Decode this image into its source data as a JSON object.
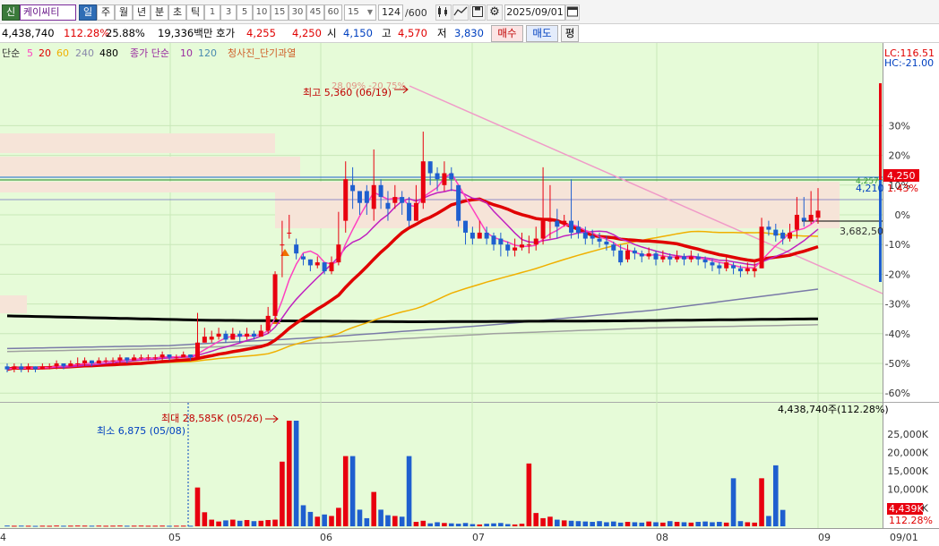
{
  "toolbar": {
    "account_tag": "신",
    "stock_name": "케이씨티",
    "periods": [
      "일",
      "주",
      "월",
      "년",
      "분",
      "초",
      "틱"
    ],
    "intervals": [
      "1",
      "3",
      "5",
      "10",
      "15",
      "30",
      "45",
      "60"
    ],
    "interval_selected": "15",
    "count": "124",
    "count_total": "/600",
    "date": "2025/09/01"
  },
  "quote": {
    "volume": "4,438,740",
    "volume_ratio": "112.28%",
    "turnover": "25.88%",
    "amount": "19,336백만",
    "ask_label": "호가",
    "ask_price": "4,255",
    "bid_price": "4,250",
    "open_label": "시",
    "open": "4,150",
    "high_label": "고",
    "high": "4,570",
    "low_label": "저",
    "low": "3,830",
    "buy_label": "매수",
    "sell_label": "매도",
    "eval_label": "평"
  },
  "legend": {
    "ma_label": "단순",
    "ma_5": "5",
    "ma_20": "20",
    "ma_60": "60",
    "ma_240": "240",
    "ma_480": "480",
    "vol_label": "종가 단순",
    "vol_10": "10",
    "vol_120": "120",
    "signal": "청사진_단기과열",
    "lc": "LC:116.51",
    "hc": "HC:-21.00"
  },
  "price_axis": [
    "30%",
    "20%",
    "10%",
    "0%",
    "-10%",
    "-20%",
    "-30%",
    "-40%",
    "-50%",
    "-60%"
  ],
  "price_tags": {
    "current": "4,250",
    "current_pct": "1.43%",
    "prev": "4,210",
    "prev_small": "4,257",
    "level": "3,682,50"
  },
  "annotations": {
    "high": "최고 5,360 (06/19)",
    "high_sub": "28.09% -20.75%",
    "vol_max": "최대 28,585K (05/26)",
    "vol_min": "최소 6,875 (05/08)",
    "vol_total": "4,438,740주(112.28%)"
  },
  "volume_axis": [
    "25,000K",
    "20,000K",
    "15,000K",
    "10,000K",
    "5,000K"
  ],
  "volume_tags": {
    "current": "4,439K",
    "pct": "112.28%"
  },
  "x_axis": [
    "4",
    "05",
    "06",
    "07",
    "08",
    "09",
    "09/01"
  ],
  "colors": {
    "up": "#e8000f",
    "down": "#1f5fcf",
    "bg": "#e6fbd8",
    "ma5": "#ff40c0",
    "ma20": "#e00000",
    "ma60": "#f0b000",
    "ma480": "#000000"
  },
  "chart_data": {
    "type": "candlestick",
    "price_axis_pct": [
      30,
      20,
      10,
      0,
      -10,
      -20,
      -30,
      -40,
      -50,
      -60
    ],
    "price_range_pct": [
      -65,
      35
    ],
    "volume_range_K": [
      0,
      28585
    ],
    "volume_axis_K": [
      25000,
      20000,
      15000,
      10000,
      5000
    ],
    "candles": [
      {
        "c": -52,
        "h": -50,
        "l": -53,
        "o": -51
      },
      {
        "c": -51,
        "h": -50,
        "l": -53,
        "o": -52
      },
      {
        "c": -52,
        "h": -50,
        "l": -53,
        "o": -51
      },
      {
        "c": -51,
        "h": -50,
        "l": -53,
        "o": -52
      },
      {
        "c": -52,
        "h": -51,
        "l": -53,
        "o": -51
      },
      {
        "c": -51,
        "h": -50,
        "l": -52,
        "o": -52
      },
      {
        "c": -51,
        "h": -50,
        "l": -52,
        "o": -51
      },
      {
        "c": -50,
        "h": -49,
        "l": -52,
        "o": -51
      },
      {
        "c": -51,
        "h": -50,
        "l": -52,
        "o": -50
      },
      {
        "c": -50,
        "h": -49,
        "l": -51,
        "o": -51
      },
      {
        "c": -50,
        "h": -48,
        "l": -51,
        "o": -50
      },
      {
        "c": -49,
        "h": -48,
        "l": -51,
        "o": -50
      },
      {
        "c": -50,
        "h": -49,
        "l": -51,
        "o": -49
      },
      {
        "c": -49,
        "h": -48,
        "l": -50,
        "o": -50
      },
      {
        "c": -49,
        "h": -48,
        "l": -50,
        "o": -49
      },
      {
        "c": -49,
        "h": -48,
        "l": -50,
        "o": -49
      },
      {
        "c": -48,
        "h": -47,
        "l": -50,
        "o": -49
      },
      {
        "c": -49,
        "h": -48,
        "l": -50,
        "o": -48
      },
      {
        "c": -48,
        "h": -47,
        "l": -49,
        "o": -49
      },
      {
        "c": -48,
        "h": -47,
        "l": -49,
        "o": -48
      },
      {
        "c": -48,
        "h": -47,
        "l": -49,
        "o": -48
      },
      {
        "c": -48,
        "h": -47,
        "l": -49,
        "o": -48
      },
      {
        "c": -47,
        "h": -46,
        "l": -49,
        "o": -48
      },
      {
        "c": -48,
        "h": -47,
        "l": -49,
        "o": -47
      },
      {
        "c": -48,
        "h": -47,
        "l": -49,
        "o": -48
      },
      {
        "c": -47,
        "h": -46,
        "l": -48,
        "o": -48
      },
      {
        "c": -48,
        "h": -47,
        "l": -49,
        "o": -47
      },
      {
        "c": -43,
        "h": -33,
        "l": -48,
        "o": -48
      },
      {
        "c": -41,
        "h": -38,
        "l": -43,
        "o": -43
      },
      {
        "c": -41,
        "h": -39,
        "l": -43,
        "o": -42
      },
      {
        "c": -40,
        "h": -38,
        "l": -42,
        "o": -41
      },
      {
        "c": -42,
        "h": -39,
        "l": -43,
        "o": -40
      },
      {
        "c": -40,
        "h": -38,
        "l": -42,
        "o": -42
      },
      {
        "c": -41,
        "h": -39,
        "l": -43,
        "o": -40
      },
      {
        "c": -40,
        "h": -38,
        "l": -42,
        "o": -41
      },
      {
        "c": -41,
        "h": -39,
        "l": -42,
        "o": -40
      },
      {
        "c": -39,
        "h": -37,
        "l": -41,
        "o": -41
      },
      {
        "c": -34,
        "h": -31,
        "l": -40,
        "o": -39
      },
      {
        "c": -20,
        "h": -19,
        "l": -35,
        "o": -34
      },
      {
        "c": -10,
        "h": -2,
        "l": -21,
        "o": -10
      },
      {
        "c": -6,
        "h": 0,
        "l": -8,
        "o": -6
      },
      {
        "c": -13,
        "h": -8,
        "l": -15,
        "o": -10
      },
      {
        "c": -15,
        "h": -13,
        "l": -17,
        "o": -14
      },
      {
        "c": -17,
        "h": -15,
        "l": -19,
        "o": -15
      },
      {
        "c": -16,
        "h": -14,
        "l": -18,
        "o": -17
      },
      {
        "c": -19,
        "h": -16,
        "l": -20,
        "o": -16
      },
      {
        "c": -16,
        "h": -14,
        "l": -20,
        "o": -19
      },
      {
        "c": -10,
        "h": 1,
        "l": -17,
        "o": -16
      },
      {
        "c": 12,
        "h": 18,
        "l": -6,
        "o": -2
      },
      {
        "c": 8,
        "h": 16,
        "l": 2,
        "o": 10
      },
      {
        "c": 4,
        "h": 8,
        "l": 0,
        "o": 8
      },
      {
        "c": 4,
        "h": 10,
        "l": 0,
        "o": 8
      },
      {
        "c": 10,
        "h": 22,
        "l": -2,
        "o": 2
      },
      {
        "c": 6,
        "h": 12,
        "l": 2,
        "o": 10
      },
      {
        "c": 2,
        "h": 8,
        "l": -2,
        "o": 4
      },
      {
        "c": 6,
        "h": 10,
        "l": 2,
        "o": 4
      },
      {
        "c": 4,
        "h": 8,
        "l": 0,
        "o": 6
      },
      {
        "c": -2,
        "h": 6,
        "l": -4,
        "o": 4
      },
      {
        "c": 4,
        "h": 10,
        "l": -2,
        "o": -2
      },
      {
        "c": 18,
        "h": 28,
        "l": 2,
        "o": 4
      },
      {
        "c": 14,
        "h": 18,
        "l": 10,
        "o": 18
      },
      {
        "c": 12,
        "h": 16,
        "l": 8,
        "o": 14
      },
      {
        "c": 14,
        "h": 18,
        "l": 8,
        "o": 10
      },
      {
        "c": 12,
        "h": 16,
        "l": 8,
        "o": 14
      },
      {
        "c": -2,
        "h": 10,
        "l": -4,
        "o": 10
      },
      {
        "c": -6,
        "h": -2,
        "l": -10,
        "o": -2
      },
      {
        "c": -8,
        "h": -4,
        "l": -10,
        "o": -6
      },
      {
        "c": -6,
        "h": -2,
        "l": -8,
        "o": -8
      },
      {
        "c": -8,
        "h": -4,
        "l": -10,
        "o": -6
      },
      {
        "c": -10,
        "h": -6,
        "l": -12,
        "o": -7
      },
      {
        "c": -10,
        "h": -6,
        "l": -14,
        "o": -8
      },
      {
        "c": -12,
        "h": -9,
        "l": -14,
        "o": -10
      },
      {
        "c": -11,
        "h": -8,
        "l": -14,
        "o": -12
      },
      {
        "c": -10,
        "h": -6,
        "l": -12,
        "o": -11
      },
      {
        "c": -10,
        "h": -7,
        "l": -13,
        "o": -10
      },
      {
        "c": -8,
        "h": -4,
        "l": -12,
        "o": -10
      },
      {
        "c": -2,
        "h": 16,
        "l": -10,
        "o": -8
      },
      {
        "c": -2,
        "h": 10,
        "l": -8,
        "o": -2
      },
      {
        "c": -4,
        "h": 2,
        "l": -8,
        "o": -2
      },
      {
        "c": -2,
        "h": 0,
        "l": -4,
        "o": -3
      },
      {
        "c": -6,
        "h": 12,
        "l": -8,
        "o": -2
      },
      {
        "c": -6,
        "h": -2,
        "l": -8,
        "o": -4
      },
      {
        "c": -8,
        "h": -4,
        "l": -10,
        "o": -6
      },
      {
        "c": -8,
        "h": -5,
        "l": -10,
        "o": -7
      },
      {
        "c": -9,
        "h": -6,
        "l": -11,
        "o": -8
      },
      {
        "c": -10,
        "h": -7,
        "l": -12,
        "o": -9
      },
      {
        "c": -12,
        "h": -9,
        "l": -14,
        "o": -10
      },
      {
        "c": -16,
        "h": -10,
        "l": -17,
        "o": -12
      },
      {
        "c": -12,
        "h": -10,
        "l": -16,
        "o": -15
      },
      {
        "c": -13,
        "h": -11,
        "l": -15,
        "o": -12
      },
      {
        "c": -14,
        "h": -12,
        "l": -16,
        "o": -13
      },
      {
        "c": -13,
        "h": -11,
        "l": -15,
        "o": -14
      },
      {
        "c": -15,
        "h": -12,
        "l": -17,
        "o": -13
      },
      {
        "c": -14,
        "h": -12,
        "l": -16,
        "o": -15
      },
      {
        "c": -15,
        "h": -13,
        "l": -17,
        "o": -14
      },
      {
        "c": -14,
        "h": -12,
        "l": -16,
        "o": -15
      },
      {
        "c": -15,
        "h": -13,
        "l": -17,
        "o": -14
      },
      {
        "c": -14,
        "h": -12,
        "l": -16,
        "o": -15
      },
      {
        "c": -15,
        "h": -13,
        "l": -17,
        "o": -14
      },
      {
        "c": -16,
        "h": -14,
        "l": -18,
        "o": -15
      },
      {
        "c": -17,
        "h": -15,
        "l": -19,
        "o": -16
      },
      {
        "c": -18,
        "h": -16,
        "l": -20,
        "o": -17
      },
      {
        "c": -16,
        "h": -14,
        "l": -19,
        "o": -18
      },
      {
        "c": -18,
        "h": -16,
        "l": -20,
        "o": -17
      },
      {
        "c": -19,
        "h": -17,
        "l": -21,
        "o": -18
      },
      {
        "c": -18,
        "h": -16,
        "l": -20,
        "o": -19
      },
      {
        "c": -18,
        "h": -15,
        "l": -21,
        "o": -19
      },
      {
        "c": -4,
        "h": -1,
        "l": -18,
        "o": -18
      },
      {
        "c": -5,
        "h": -2,
        "l": -7,
        "o": -4
      },
      {
        "c": -7,
        "h": -3,
        "l": -9,
        "o": -5
      },
      {
        "c": -8,
        "h": -5,
        "l": -10,
        "o": -6
      },
      {
        "c": -6,
        "h": -3,
        "l": -9,
        "o": -8
      },
      {
        "c": 0,
        "h": 6,
        "l": -8,
        "o": -5
      },
      {
        "c": -2,
        "h": 6,
        "l": -4,
        "o": -1
      },
      {
        "c": 0,
        "h": 8,
        "l": -3,
        "o": -2
      },
      {
        "c": 1.4,
        "h": 9,
        "l": -3,
        "o": -1
      }
    ],
    "volumes_K": [
      200,
      150,
      180,
      150,
      120,
      160,
      140,
      200,
      150,
      170,
      200,
      180,
      160,
      180,
      150,
      170,
      200,
      150,
      170,
      190,
      150,
      160,
      180,
      140,
      160,
      170,
      150,
      10500,
      3800,
      1800,
      1300,
      1600,
      1800,
      1500,
      1700,
      1400,
      1500,
      1700,
      1800,
      17500,
      28585,
      28585,
      5700,
      3900,
      2600,
      3200,
      2800,
      5000,
      19000,
      19000,
      4500,
      2200,
      9300,
      4500,
      3000,
      2800,
      2600,
      19000,
      1200,
      1500,
      800,
      1100,
      900,
      800,
      700,
      900,
      600,
      500,
      700,
      800,
      900,
      600,
      500,
      700,
      17000,
      3600,
      2200,
      2600,
      1800,
      1600,
      1500,
      1400,
      1300,
      1200,
      1400,
      1100,
      1300,
      1000,
      1200,
      1100,
      1000,
      1300,
      1100,
      1000,
      1400,
      1200,
      1100,
      1000,
      1200,
      1300,
      1100,
      1200,
      1000,
      13000,
      1400,
      1100,
      1000,
      13000,
      2800,
      16500,
      4439
    ],
    "ma5": [],
    "ma20": [],
    "ma60": [],
    "ma480_pct": [
      -34,
      -35.5,
      -36,
      -35.7,
      -35
    ],
    "ma240_pct": [
      -45,
      -44,
      -41,
      -37,
      -32,
      -25
    ],
    "ma120_pct": [
      -46,
      -45,
      -43,
      -40,
      -38,
      -37
    ]
  }
}
